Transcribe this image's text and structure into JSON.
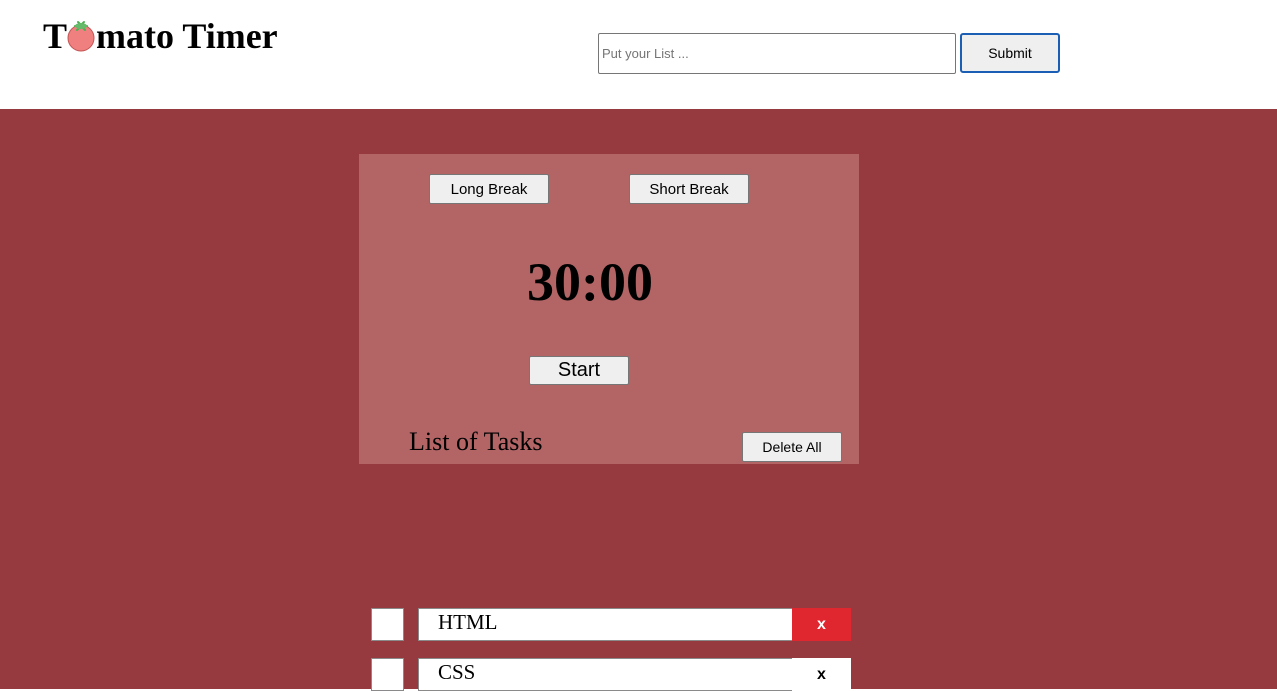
{
  "app": {
    "title_prefix": "T",
    "title_suffix": "mato Timer",
    "logo_icon": "tomato-icon"
  },
  "header": {
    "input_placeholder": "Put your List ...",
    "input_value": "",
    "submit_label": "Submit"
  },
  "timer": {
    "long_break_label": "Long Break",
    "short_break_label": "Short Break",
    "time": "30:00",
    "start_label": "Start"
  },
  "tasks": {
    "title": "List of Tasks",
    "delete_all_label": "Delete All",
    "items": [
      {
        "text": "HTML",
        "delete_label": "x",
        "delete_active": true
      },
      {
        "text": "CSS",
        "delete_label": "x",
        "delete_active": false
      }
    ]
  },
  "colors": {
    "background": "#963a3f",
    "panel": "#b36566",
    "delete_active": "#e0262f",
    "tomato": "#f08080"
  }
}
